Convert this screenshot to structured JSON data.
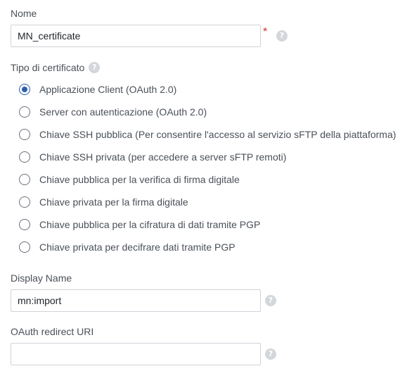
{
  "form": {
    "name": {
      "label": "Nome",
      "value": "MN_certificate",
      "required_mark": "*"
    },
    "certificate_type": {
      "label": "Tipo di certificato",
      "selected_index": 0,
      "options": [
        "Applicazione Client (OAuth 2.0)",
        "Server con autenticazione (OAuth 2.0)",
        "Chiave SSH pubblica (Per consentire l'accesso al servizio sFTP della piattaforma)",
        "Chiave SSH privata (per accedere a server sFTP remoti)",
        "Chiave pubblica per la verifica di firma digitale",
        "Chiave privata per la firma digitale",
        "Chiave pubblica per la cifratura di dati tramite PGP",
        "Chiave privata per decifrare dati tramite PGP"
      ]
    },
    "display_name": {
      "label": "Display Name",
      "value": "mn:import"
    },
    "redirect_uri": {
      "label": "OAuth redirect URI",
      "value": ""
    }
  },
  "icons": {
    "help": "question-circle-icon",
    "help_glyph": "?"
  },
  "colors": {
    "accent": "#2b5fae",
    "required": "#d0342c",
    "help_icon": "#d3d6da",
    "border": "#cfd3d8"
  }
}
